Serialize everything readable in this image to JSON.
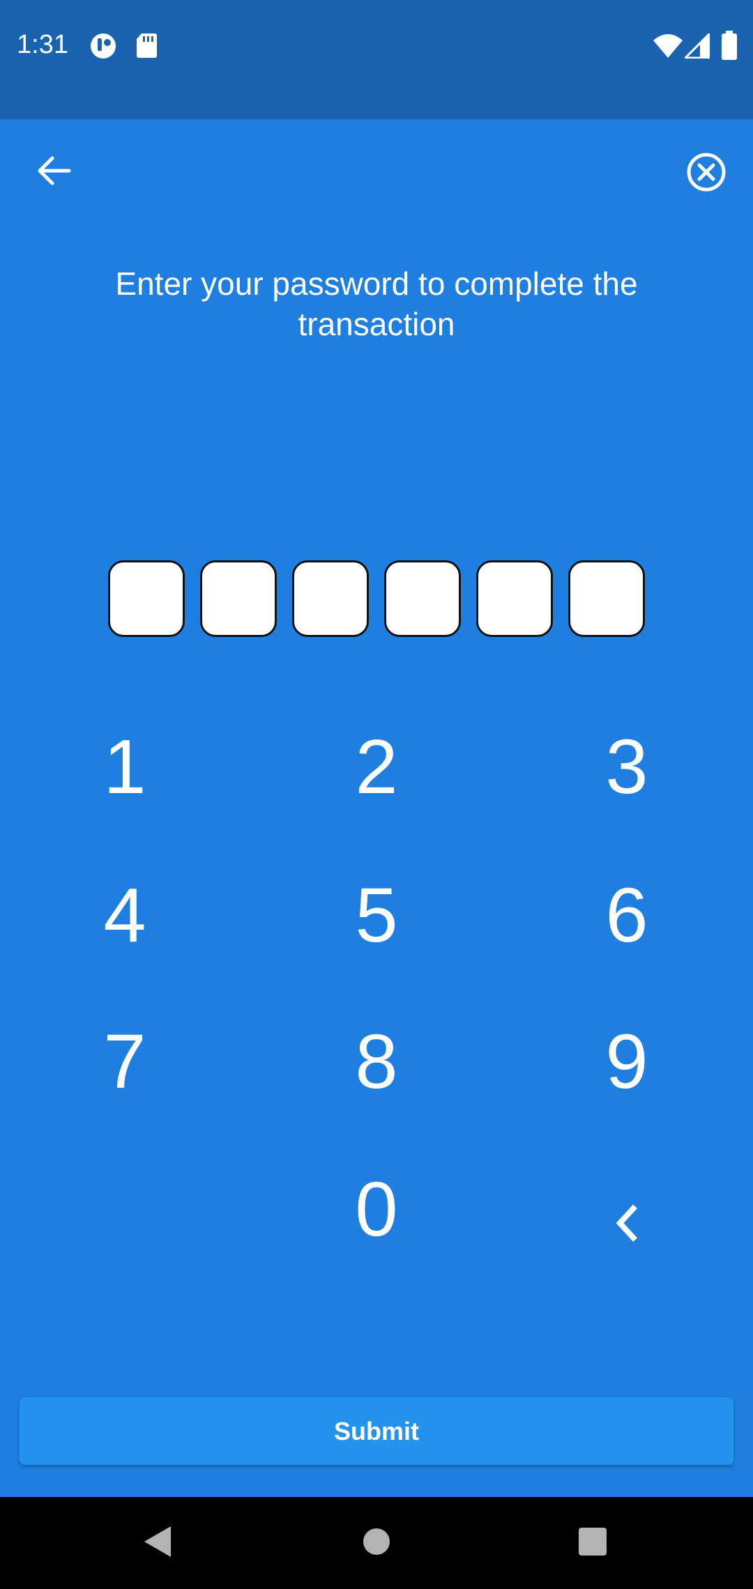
{
  "status_bar": {
    "time": "1:31",
    "icons_left": [
      "app-notification-icon",
      "sd-card-icon"
    ],
    "icons_right": [
      "wifi-icon",
      "cellular-signal-icon",
      "battery-icon"
    ]
  },
  "header": {
    "back_icon": "arrow-left-icon",
    "close_icon": "circle-x-icon"
  },
  "prompt": {
    "text": "Enter your password to complete the transaction"
  },
  "pin": {
    "length": 6,
    "filled": 0
  },
  "keypad": {
    "keys": [
      "1",
      "2",
      "3",
      "4",
      "5",
      "6",
      "7",
      "8",
      "9",
      "",
      "0",
      "<"
    ]
  },
  "submit": {
    "label": "Submit"
  },
  "navigation": {
    "back_icon": "nav-back-icon",
    "home_icon": "nav-home-icon",
    "recents_icon": "nav-recents-icon"
  },
  "colors": {
    "background": "#1e7fe0",
    "status_bar": "#1a63b0",
    "submit_button": "#2493ee",
    "text": "#ffffff",
    "nav_bar": "#000000"
  }
}
